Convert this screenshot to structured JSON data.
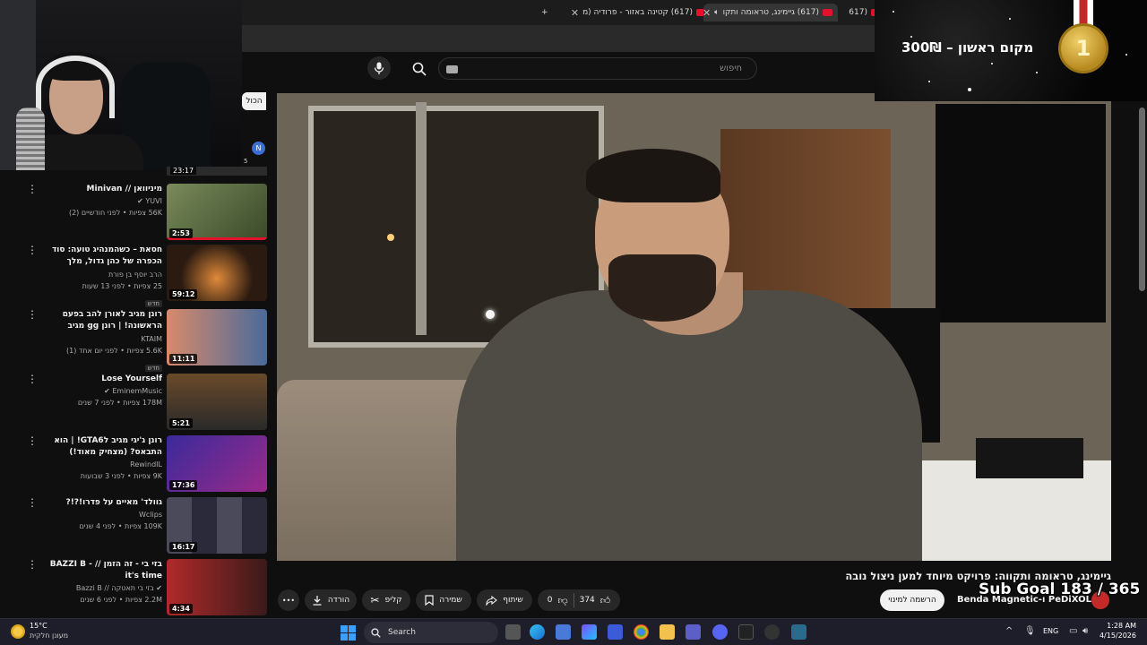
{
  "browser": {
    "tabs": [
      {
        "title": "(617) גיימינג, טראומה ותקו",
        "active": true
      },
      {
        "title": "(617) קטינה באזור - פרודיה (מ",
        "active": false
      },
      {
        "title": "(617",
        "active": false
      }
    ],
    "new_tab_symbol": "+",
    "close_symbol": "✕"
  },
  "search": {
    "placeholder": "חיפוש"
  },
  "filters": {
    "all_chip": "הכול"
  },
  "mini_item": {
    "avatar_letter": "N",
    "count": "5",
    "duration": "23:17"
  },
  "sidebar": {
    "videos": [
      {
        "title": "מיניוואן // Minivan",
        "channel": "YUVI",
        "verified": true,
        "stats": "56K צפיות • לפני חודשיים (2)",
        "duration": "2:53",
        "badge": "",
        "thumb_color": "#5a6a3a"
      },
      {
        "title": "חסאת – כשהמנהיג טועה: סוד הכפרה של כהן גדול, מלך והציבור | ...",
        "channel": "הרב יוסף בן פורת",
        "verified": false,
        "stats": "25 צפיות • לפני 13 שעות",
        "duration": "59:12",
        "badge": "חדש",
        "thumb_color": "#3a2a1a"
      },
      {
        "title": "רונן מגיב לאורן להב בפעם הראשונה! | רונן gg מגיב לטיקטוקים",
        "channel": "KTAIM",
        "verified": false,
        "stats": "5.6K צפיות • לפני יום אחד (1)",
        "duration": "11:11",
        "badge": "חדש",
        "thumb_color": "#b65a4a"
      },
      {
        "title": "Lose Yourself",
        "channel": "EminemMusic",
        "verified": true,
        "stats": "178M צפיות • לפני 7 שנים",
        "duration": "5:21",
        "badge": "",
        "thumb_color": "#4a3a2a"
      },
      {
        "title": "רונן ג'יגי מגיב לGTA6! | הוא התבאס? (מצחיק מאוד!)",
        "channel": "RewindIL",
        "verified": false,
        "stats": "9K צפיות • לפני 3 שבועות",
        "duration": "17:36",
        "badge": "",
        "thumb_color": "#6a2a8a"
      },
      {
        "title": "גוולד' מאיים על פדרו!?!?",
        "channel": "Wclips",
        "verified": false,
        "stats": "109K צפיות • לפני 4 שנים",
        "duration": "16:17",
        "badge": "",
        "thumb_color": "#3a3a4a"
      },
      {
        "title": "בזי בי - זה הזמן // BAZZI B - it's time",
        "channel": "בזי בי תאטקה // Bazzi B",
        "verified": true,
        "stats": "2.2M צפיות • לפני 6 שנים",
        "duration": "4:34",
        "badge": "",
        "thumb_color": "#8a2a2a"
      }
    ]
  },
  "video": {
    "title": "גיימינג, טראומה ותקווה: פרויקט מיוחד למען ניצול נובה",
    "channel": "Benda Magnetic-ו PeDiXOL",
    "subscribe_label": "הרשמה למינוי",
    "like_count": "374",
    "dislike_count": "0",
    "share_label": "שיתוף",
    "save_label": "שמירה",
    "clip_label": "קליפ",
    "download_label": "הורדה",
    "more_symbol": "•••"
  },
  "overlay": {
    "sub_goal": "Sub Goal 183 / 365",
    "prize_text": "מקום ראשון – 300₪",
    "medal_number": "1"
  },
  "taskbar": {
    "weather_temp": "15°C",
    "weather_desc": "מעונן חלקית",
    "search_label": "Search",
    "language": "ENG",
    "time": "1:28 AM",
    "date": "4/15/2026"
  },
  "colors": {
    "youtube_red": "#e1122a",
    "accent_blue": "#3aa0ff",
    "background": "#0f0f0f"
  }
}
